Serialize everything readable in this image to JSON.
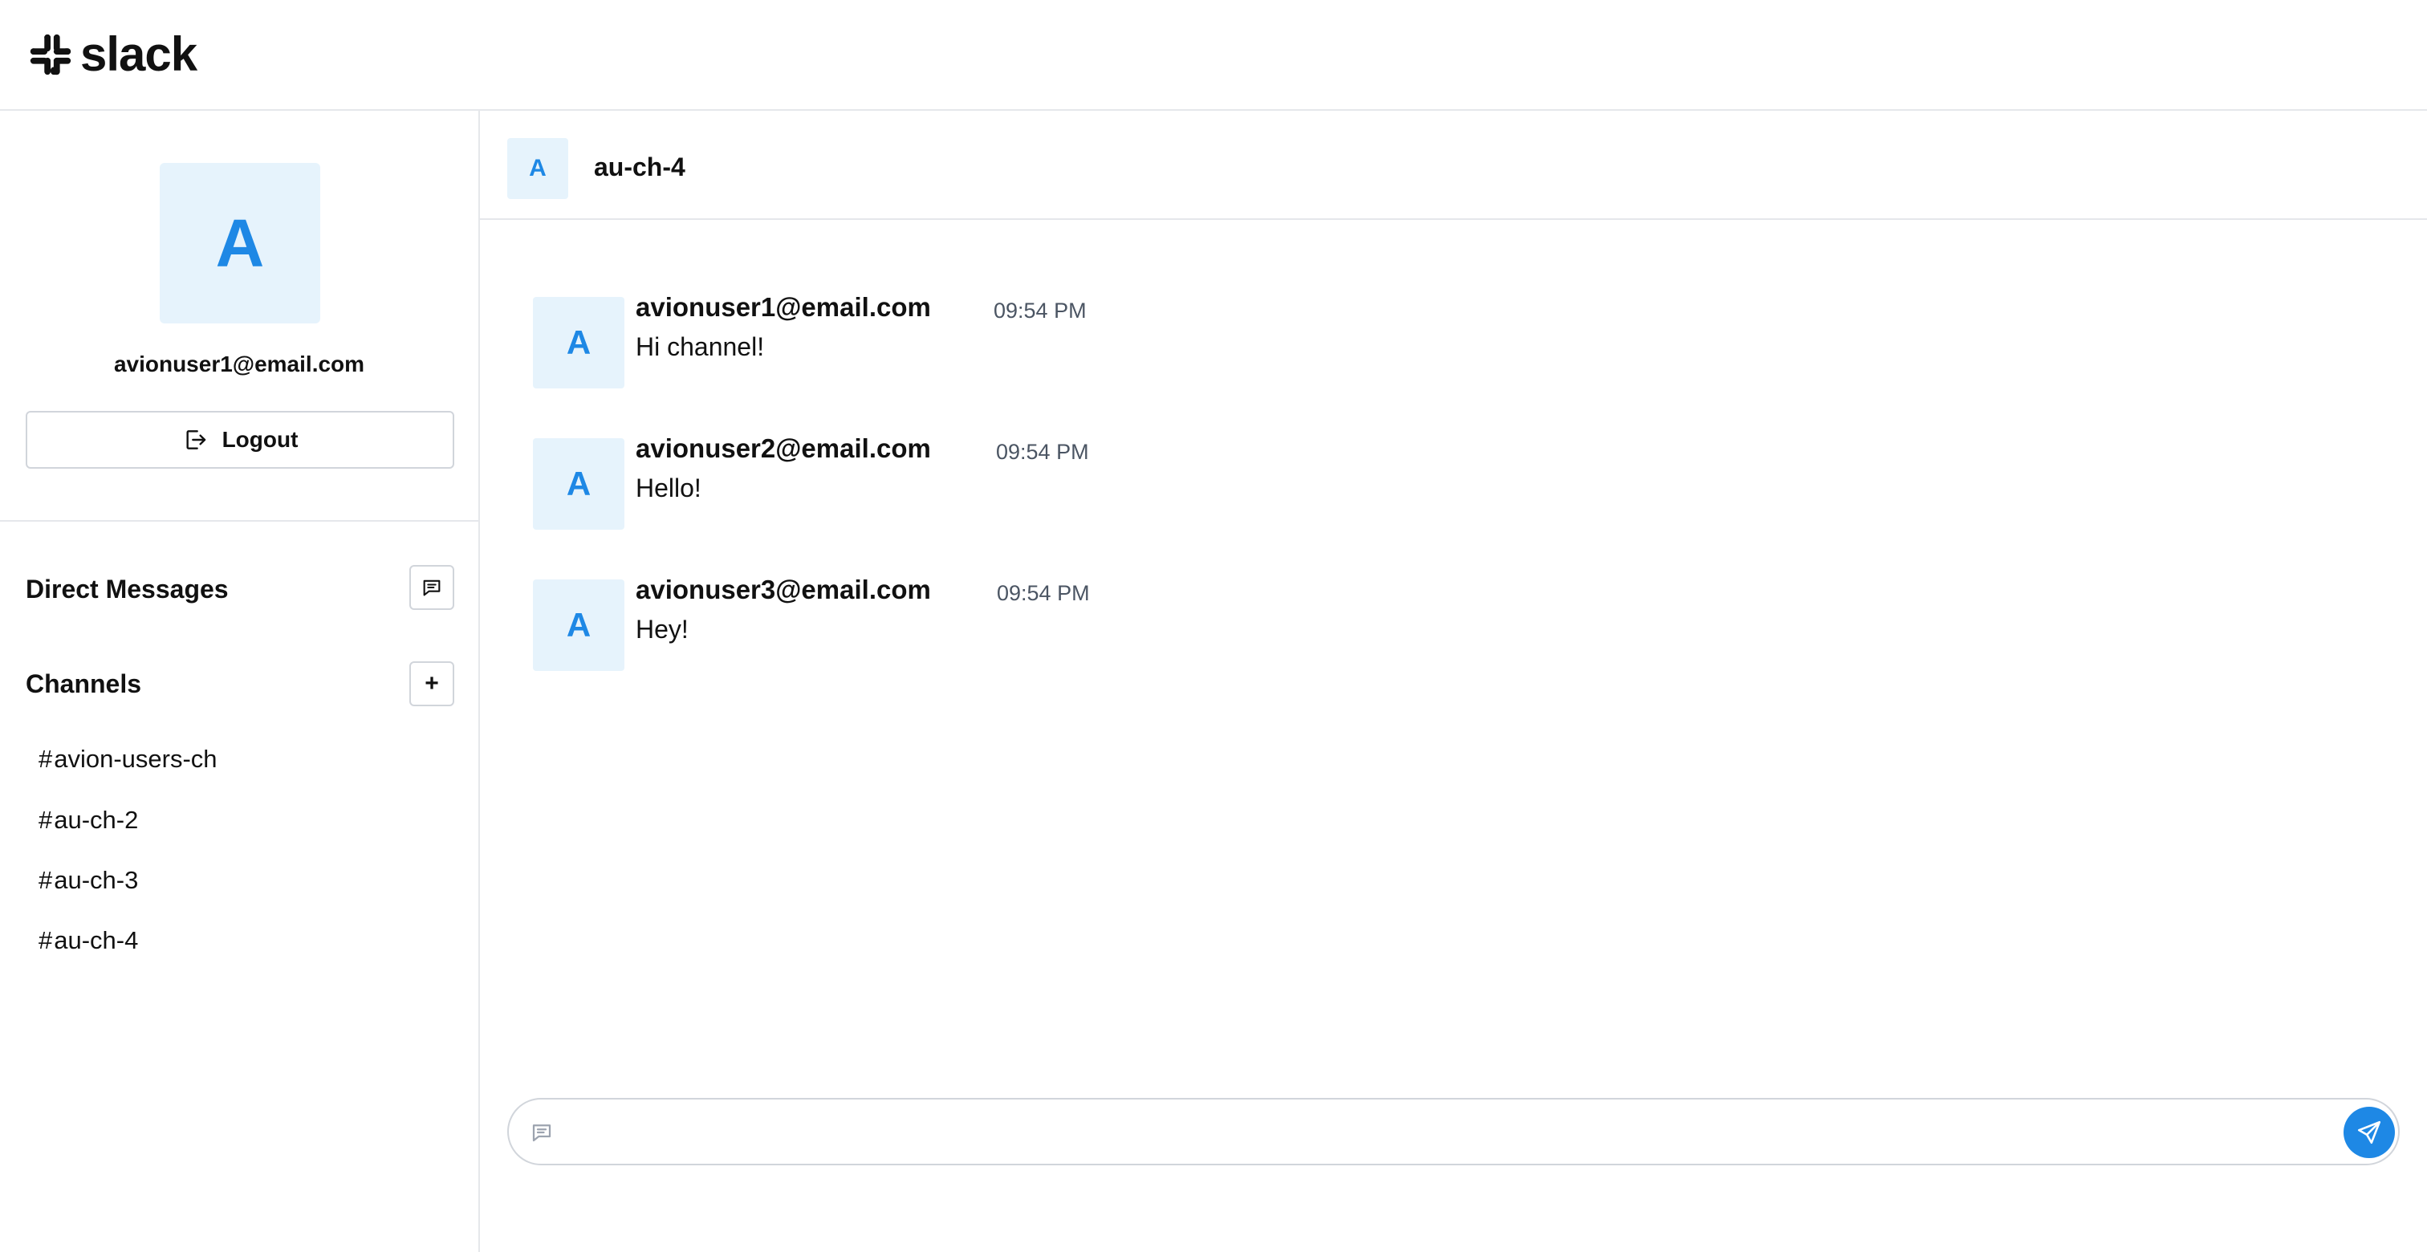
{
  "app": {
    "logo_text": "slack",
    "accent_color": "#1e88e5",
    "avatar_bg": "#e6f3fc"
  },
  "profile": {
    "avatar_initial": "A",
    "email": "avionuser1@email.com",
    "logout_label": "Logout",
    "logout_icon": "logout-icon"
  },
  "sidebar": {
    "direct_messages_title": "Direct Messages",
    "direct_messages_button_icon": "new-message-icon",
    "channels_title": "Channels",
    "add_channel_label": "+",
    "channels": [
      {
        "hash": "#",
        "name": "avion-users-ch"
      },
      {
        "hash": "#",
        "name": "au-ch-2"
      },
      {
        "hash": "#",
        "name": "au-ch-3"
      },
      {
        "hash": "#",
        "name": "au-ch-4"
      }
    ]
  },
  "channel": {
    "avatar_initial": "A",
    "name": "au-ch-4"
  },
  "messages": [
    {
      "avatar_initial": "A",
      "author": "avionuser1@email.com",
      "time": "09:54 PM",
      "text": "Hi channel!"
    },
    {
      "avatar_initial": "A",
      "author": "avionuser2@email.com",
      "time": "09:54 PM",
      "text": "Hello!"
    },
    {
      "avatar_initial": "A",
      "author": "avionuser3@email.com",
      "time": "09:54 PM",
      "text": "Hey!"
    }
  ],
  "composer": {
    "placeholder": "",
    "input_icon": "message-icon",
    "send_icon": "send-icon"
  }
}
